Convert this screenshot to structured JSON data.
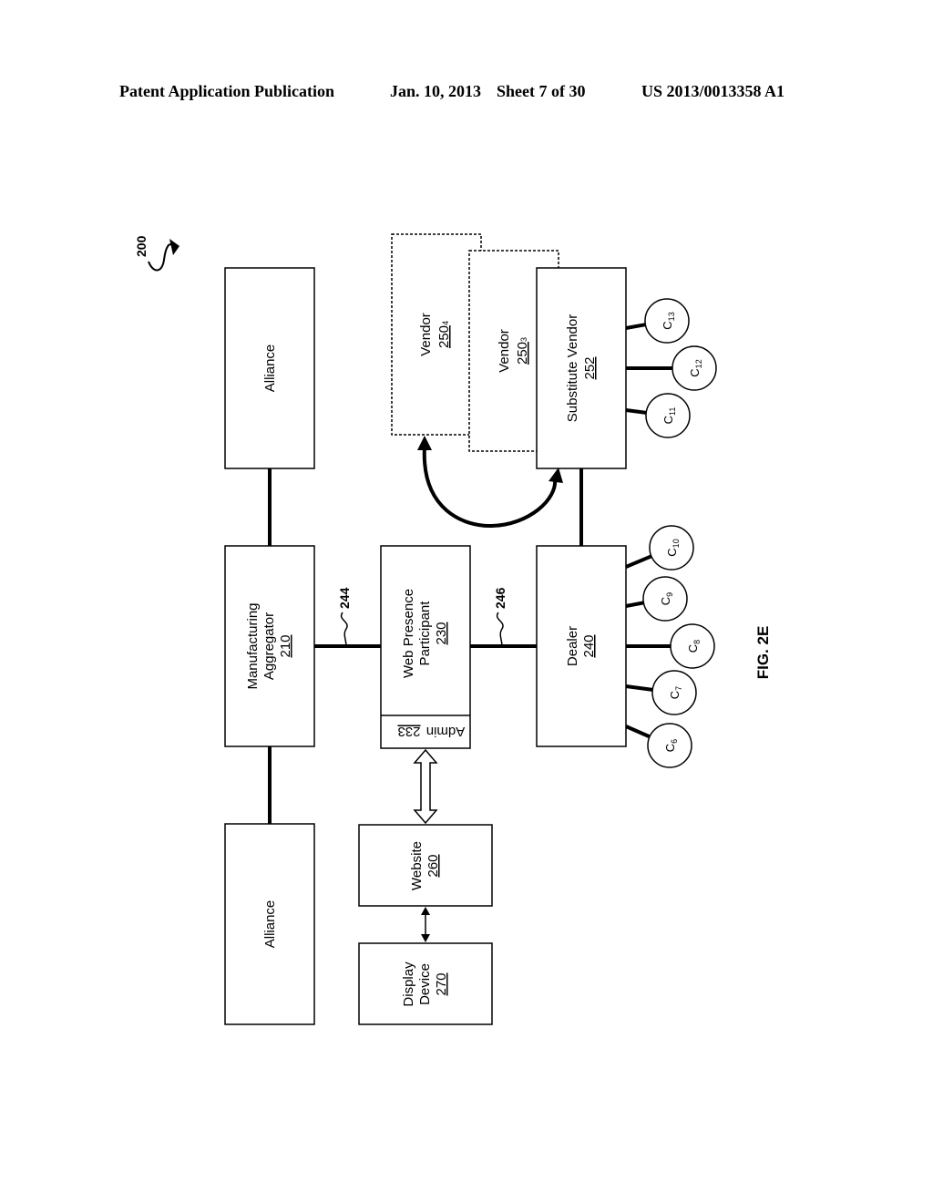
{
  "header": {
    "publication": "Patent Application Publication",
    "date": "Jan. 10, 2013",
    "sheet": "Sheet 7 of 30",
    "number": "US 2013/0013358 A1"
  },
  "figure": {
    "ref": "200",
    "caption": "FIG. 2E",
    "blocks": {
      "alliance_top": {
        "label": "Alliance"
      },
      "alliance_bottom": {
        "label": "Alliance"
      },
      "manufacturing_aggregator": {
        "line1": "Manufacturing",
        "line2": "Aggregator",
        "ref": "210"
      },
      "web_presence": {
        "line1": "Web Presence",
        "line2": "Participant",
        "ref": "230"
      },
      "admin": {
        "label": "Admin",
        "ref": "233"
      },
      "dealer": {
        "line1": "Dealer",
        "ref": "240"
      },
      "website": {
        "line1": "Website",
        "ref": "260"
      },
      "display_device": {
        "line1": "Display",
        "line2": "Device",
        "ref": "270"
      },
      "vendor4": {
        "line1": "Vendor",
        "ref": "250",
        "sub": "4"
      },
      "vendor3": {
        "line1": "Vendor",
        "ref": "250",
        "sub": "3"
      },
      "substitute_vendor": {
        "line1": "Substitute Vendor",
        "ref": "252"
      }
    },
    "links": {
      "l244": "244",
      "l246": "246"
    },
    "customers_dealer": [
      {
        "base": "C",
        "sub": "6"
      },
      {
        "base": "C",
        "sub": "7"
      },
      {
        "base": "C",
        "sub": "8"
      },
      {
        "base": "C",
        "sub": "9"
      },
      {
        "base": "C",
        "sub": "10"
      }
    ],
    "customers_vendor": [
      {
        "base": "C",
        "sub": "11"
      },
      {
        "base": "C",
        "sub": "12"
      },
      {
        "base": "C",
        "sub": "13"
      }
    ]
  }
}
